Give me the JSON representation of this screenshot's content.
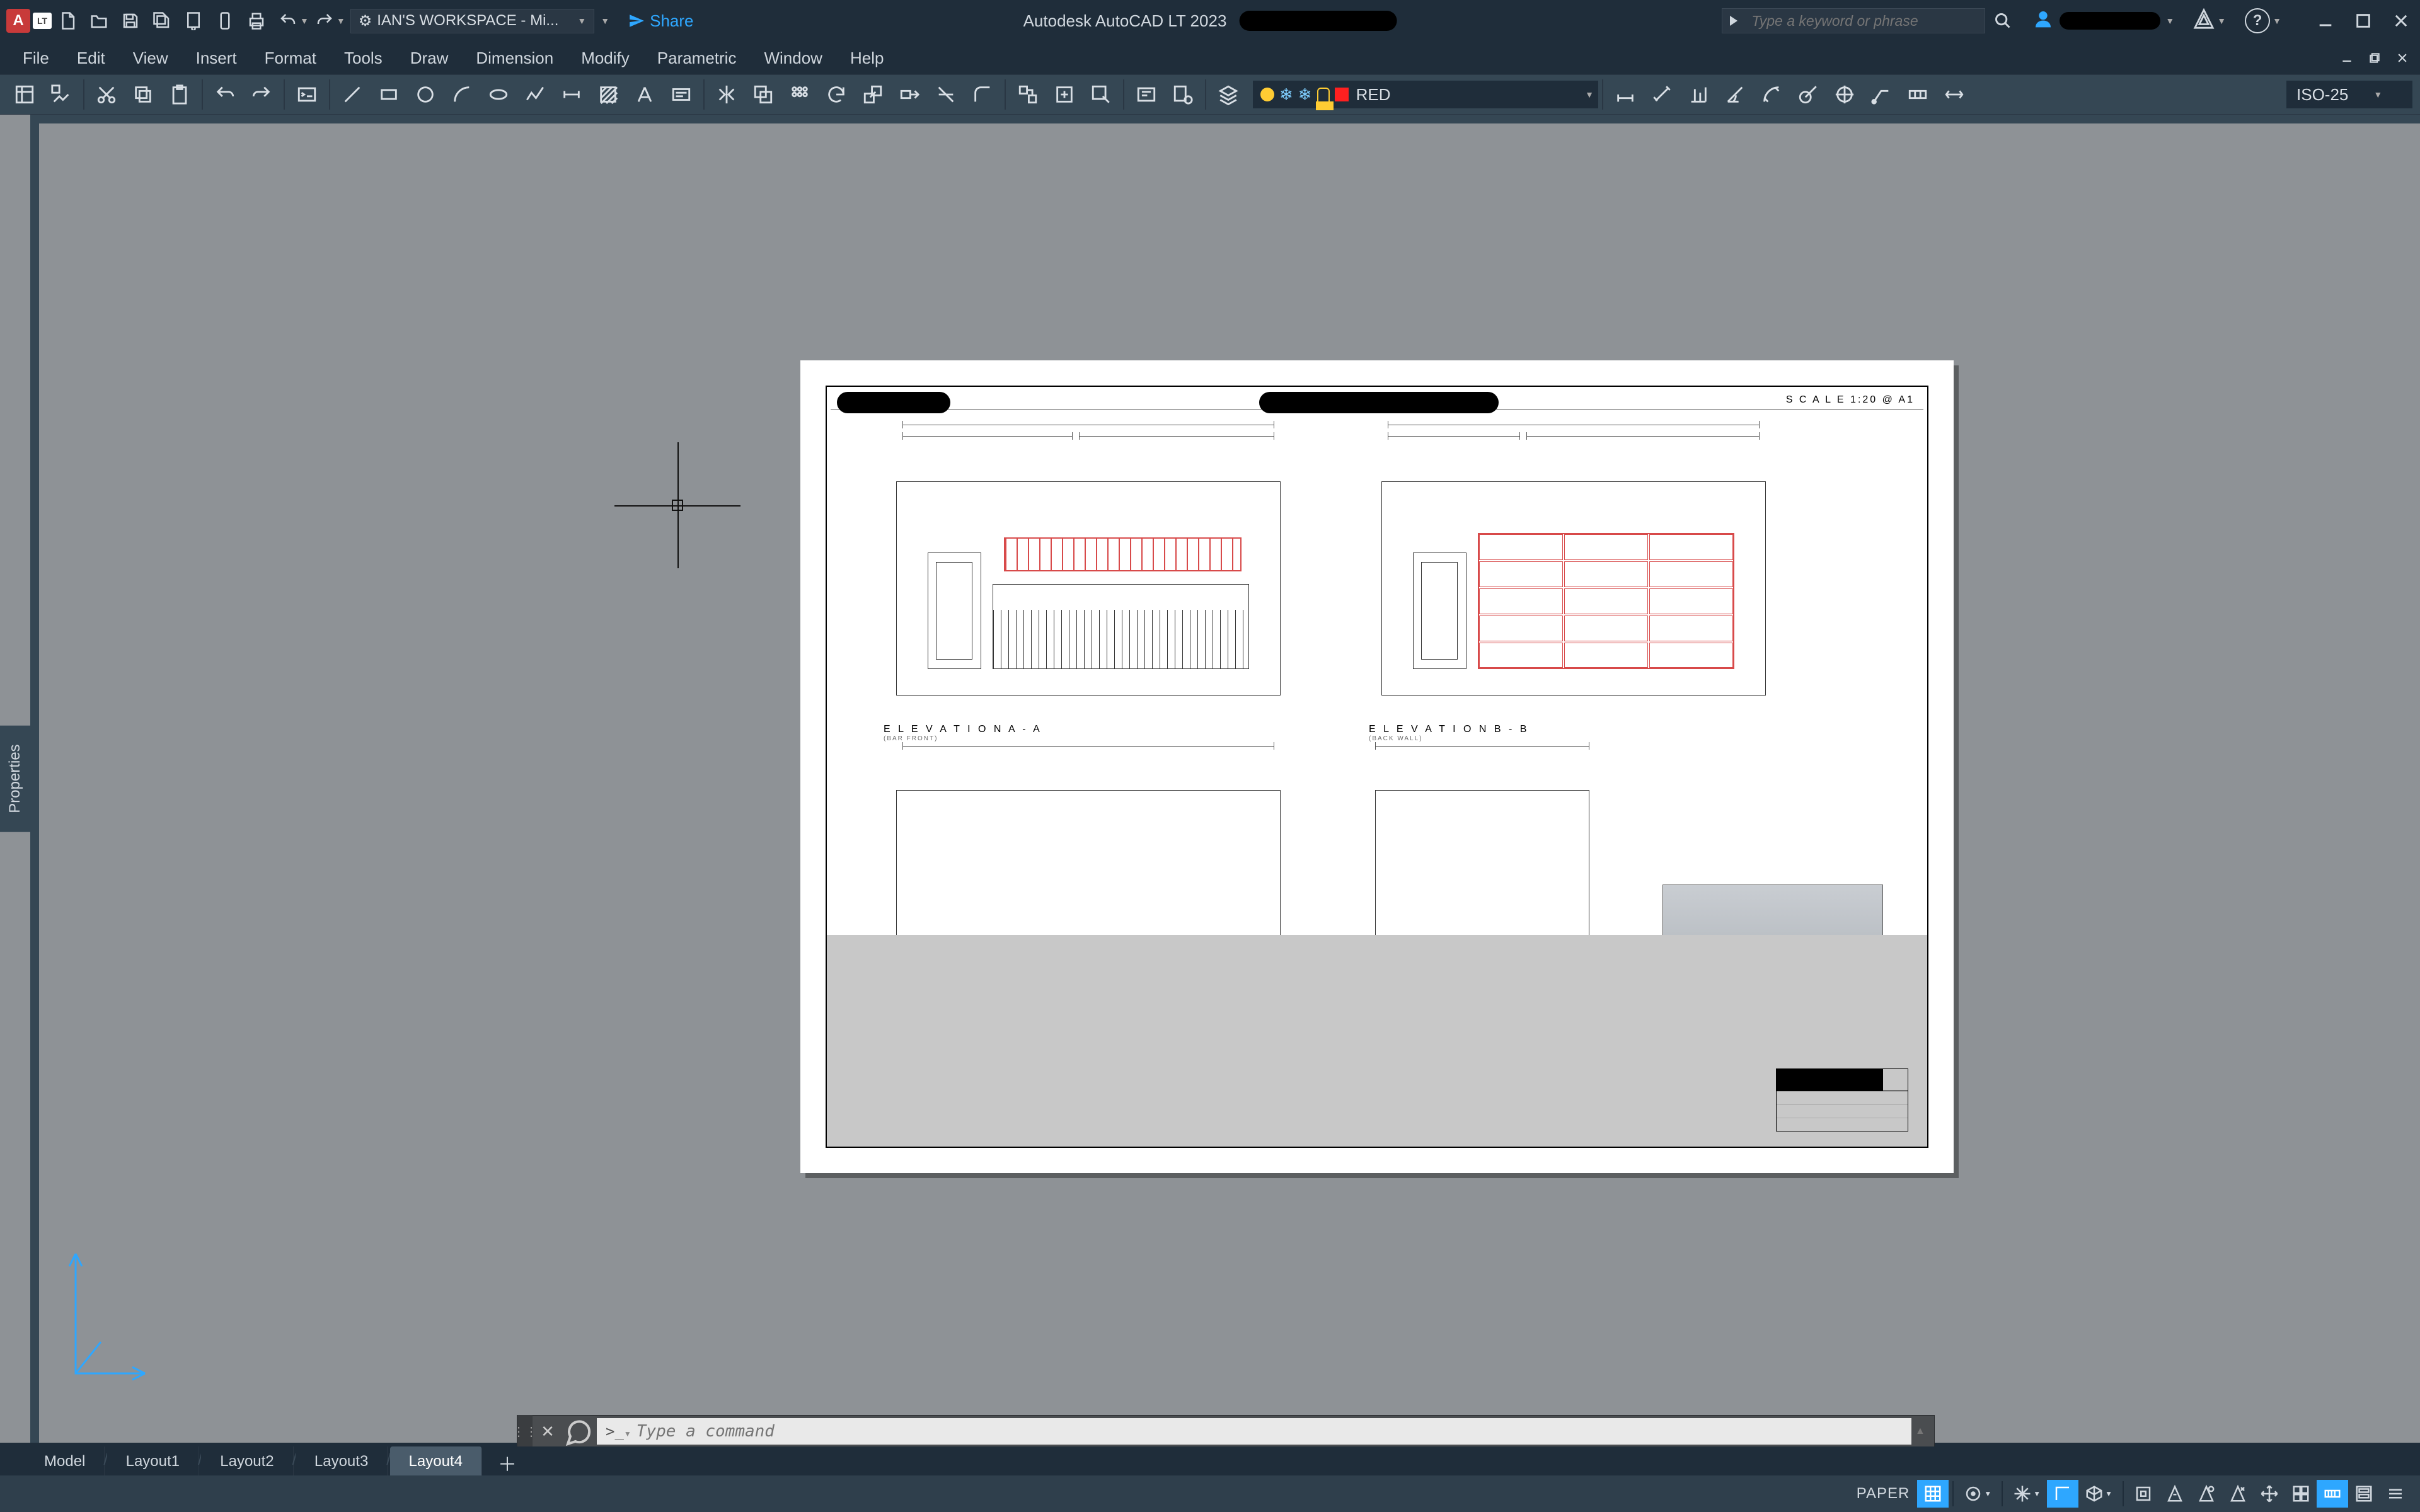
{
  "titlebar": {
    "app_initial": "A",
    "lt": "LT",
    "workspace": "IAN'S WORKSPACE - Mi...",
    "share": "Share",
    "app_title": "Autodesk AutoCAD LT 2023",
    "search_placeholder": "Type a keyword or phrase"
  },
  "menu": {
    "items": [
      "File",
      "Edit",
      "View",
      "Insert",
      "Format",
      "Tools",
      "Draw",
      "Dimension",
      "Modify",
      "Parametric",
      "Window",
      "Help"
    ]
  },
  "toolbar": {
    "layer_name": "RED",
    "dim_style": "ISO-25"
  },
  "sheet": {
    "scale_text": "S C A L E   1:20 @ A1",
    "elev_a_label": "E L E V A T I O N   A - A",
    "elev_a_sub": "(BAR  FRONT)",
    "elev_b_label": "E L E V A T I O N   B - B",
    "elev_b_sub": "(BACK  WALL)"
  },
  "command": {
    "placeholder": "Type a command"
  },
  "layout_tabs": {
    "tabs": [
      "Model",
      "Layout1",
      "Layout2",
      "Layout3",
      "Layout4"
    ],
    "active": 4
  },
  "statusbar": {
    "space": "PAPER"
  },
  "sidebar": {
    "properties": "Properties"
  }
}
